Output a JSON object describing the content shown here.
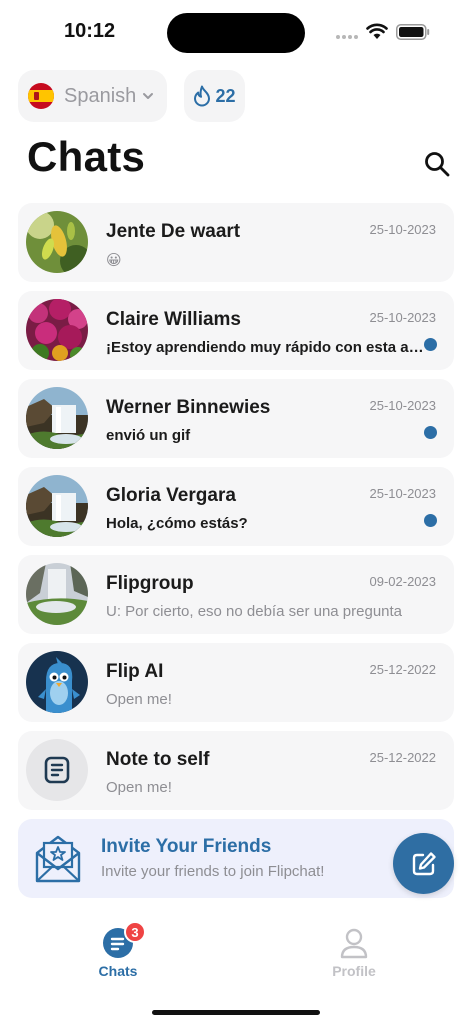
{
  "status_bar": {
    "time": "10:12"
  },
  "language": {
    "label": "Spanish",
    "flag_icon": "spain-flag-icon"
  },
  "streak": {
    "count": "22",
    "icon": "flame-icon"
  },
  "title": "Chats",
  "chats": [
    {
      "name": "Jente De waart",
      "date": "25-10-2023",
      "preview": "😀",
      "unread": false,
      "avatar": "green-pods-photo"
    },
    {
      "name": "Claire Williams",
      "date": "25-10-2023",
      "preview": "¡Estoy aprendiendo muy rápido con esta app!",
      "unread": true,
      "avatar": "pink-flowers-photo"
    },
    {
      "name": "Werner Binnewies",
      "date": "25-10-2023",
      "preview": "envió un gif",
      "unread": true,
      "avatar": "waterfall-photo"
    },
    {
      "name": "Gloria Vergara",
      "date": "25-10-2023",
      "preview": "Hola, ¿cómo estás?",
      "unread": true,
      "avatar": "waterfall-photo"
    },
    {
      "name": "Flipgroup",
      "date": "09-02-2023",
      "preview": "U: Por cierto, eso no debía ser una pregunta",
      "unread": false,
      "avatar": "waterfall-mist-photo"
    },
    {
      "name": "Flip AI",
      "date": "25-12-2022",
      "preview": "Open me!",
      "unread": false,
      "avatar": "flip-bird-mascot"
    },
    {
      "name": "Note to self",
      "date": "25-12-2022",
      "preview": "Open me!",
      "unread": false,
      "avatar": "note-icon"
    }
  ],
  "invite": {
    "title": "Invite Your Friends",
    "subtitle": "Invite your friends to join Flipchat!"
  },
  "tabs": [
    {
      "label": "Chats",
      "active": true,
      "badge": "3"
    },
    {
      "label": "Profile",
      "active": false
    }
  ],
  "colors": {
    "accent": "#2c6ea6",
    "card_bg": "#f6f6f7",
    "badge": "#ef4444",
    "invite_bg": "#eef0fc"
  }
}
